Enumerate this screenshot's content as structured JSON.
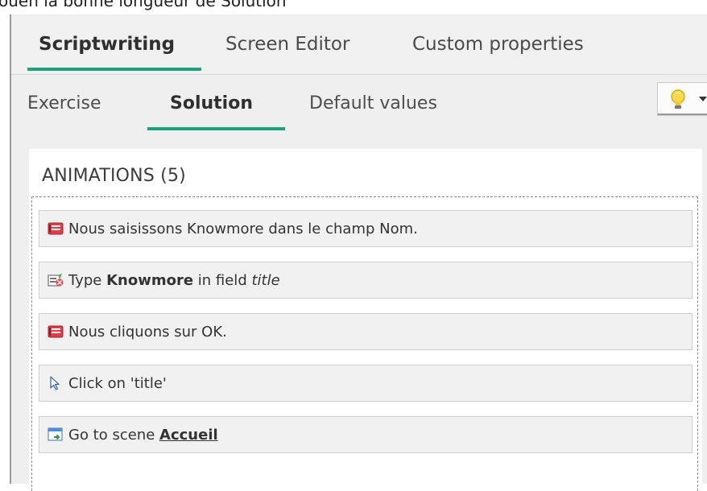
{
  "caption_fragment": "ouen la bonne longueur de Solution",
  "tabs": [
    {
      "label": "Scriptwriting",
      "active": true
    },
    {
      "label": "Screen Editor",
      "active": false
    },
    {
      "label": "Custom properties",
      "active": false
    }
  ],
  "subtabs": [
    {
      "label": "Exercise",
      "active": false
    },
    {
      "label": "Solution",
      "active": true
    },
    {
      "label": "Default values",
      "active": false
    }
  ],
  "tips_button": {
    "icon": "lightbulb-icon",
    "menu_icon": "caret-down-icon"
  },
  "animations": {
    "title": "ANIMATIONS (5)",
    "items": [
      {
        "icon": "comment-icon",
        "text": "Nous saisissons Knowmore dans le champ Nom."
      },
      {
        "icon": "type-action-icon",
        "prefix": "Type ",
        "value": "Knowmore",
        "middle": " in field ",
        "field": "title"
      },
      {
        "icon": "comment-icon",
        "text": "Nous cliquons sur OK."
      },
      {
        "icon": "cursor-icon",
        "text": "Click on 'title'"
      },
      {
        "icon": "go-to-scene-icon",
        "prefix": "Go to scene ",
        "scene": "Accueil"
      }
    ]
  },
  "colors": {
    "accent": "#1aa37e",
    "panel": "#ffffff",
    "background": "#efefef"
  }
}
